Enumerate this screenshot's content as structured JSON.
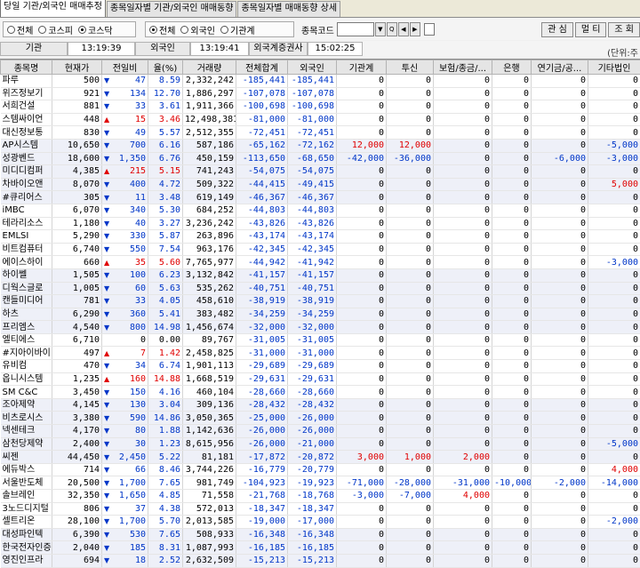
{
  "tabs": [
    "당일 기관/외국인 매매추정",
    "종목일자별 기관/외국인 매매동향",
    "종목일자별 매매동향 상세"
  ],
  "market_filter": {
    "options": [
      "전체",
      "코스피",
      "코스닥"
    ],
    "selected": "코스닥"
  },
  "investor_filter": {
    "options": [
      "전체",
      "외국인",
      "기관계"
    ],
    "selected": "전체"
  },
  "code_label": "종목코드",
  "right_buttons": [
    "관 심",
    "멀 티",
    "조 회"
  ],
  "times": {
    "inst_label": "기관",
    "inst_time": "13:19:39",
    "frgn_label": "외국인",
    "frgn_time": "13:19:41",
    "broker_label": "외국계증권사",
    "broker_time": "15:02:25"
  },
  "unit_label": "(단위:주",
  "columns": [
    "종목명",
    "현재가",
    "전일비",
    "율(%)",
    "거래량",
    "전체합계",
    "외국인",
    "기관계",
    "투신",
    "보험/종금/...",
    "은행",
    "연기금/공...",
    "기타법인"
  ],
  "colors": {
    "up": "#e00000",
    "down": "#0036c8",
    "alt_row": "#eef0f8"
  },
  "rows": [
    [
      "파루",
      "500",
      "dn",
      "47",
      "8.59",
      "2,332,242",
      "-185,441",
      "-185,441",
      "0",
      "0",
      "0",
      "0",
      "0",
      "0"
    ],
    [
      "위즈정보기",
      "921",
      "dn",
      "134",
      "12.70",
      "1,886,297",
      "-107,078",
      "-107,078",
      "0",
      "0",
      "0",
      "0",
      "0",
      "0"
    ],
    [
      "서희건설",
      "881",
      "dn",
      "33",
      "3.61",
      "1,911,366",
      "-100,698",
      "-100,698",
      "0",
      "0",
      "0",
      "0",
      "0",
      "0"
    ],
    [
      "스템싸이언",
      "448",
      "up",
      "15",
      "3.46",
      "12,498,381",
      "-81,000",
      "-81,000",
      "0",
      "0",
      "0",
      "0",
      "0",
      "0"
    ],
    [
      "대신정보통",
      "830",
      "dn",
      "49",
      "5.57",
      "2,512,355",
      "-72,451",
      "-72,451",
      "0",
      "0",
      "0",
      "0",
      "0",
      "0"
    ],
    [
      "AP시스템",
      "10,650",
      "dn",
      "700",
      "6.16",
      "587,186",
      "-65,162",
      "-72,162",
      "12,000",
      "12,000",
      "0",
      "0",
      "0",
      "-5,000"
    ],
    [
      "성광벤드",
      "18,600",
      "dn",
      "1,350",
      "6.76",
      "450,159",
      "-113,650",
      "-68,650",
      "-42,000",
      "-36,000",
      "0",
      "0",
      "-6,000",
      "-3,000"
    ],
    [
      "미디디컴퍼",
      "4,385",
      "up",
      "215",
      "5.15",
      "741,243",
      "-54,075",
      "-54,075",
      "0",
      "0",
      "0",
      "0",
      "0",
      "0"
    ],
    [
      "차바이오앤",
      "8,070",
      "dn",
      "400",
      "4.72",
      "509,322",
      "-44,415",
      "-49,415",
      "0",
      "0",
      "0",
      "0",
      "0",
      "5,000"
    ],
    [
      "#큐리어스",
      "305",
      "dn",
      "11",
      "3.48",
      "619,149",
      "-46,367",
      "-46,367",
      "0",
      "0",
      "0",
      "0",
      "0",
      "0"
    ],
    [
      "iMBC",
      "6,070",
      "dn",
      "340",
      "5.30",
      "684,252",
      "-44,803",
      "-44,803",
      "0",
      "0",
      "0",
      "0",
      "0",
      "0"
    ],
    [
      "테라리소스",
      "1,180",
      "dn",
      "40",
      "3.27",
      "3,236,242",
      "-43,826",
      "-43,826",
      "0",
      "0",
      "0",
      "0",
      "0",
      "0"
    ],
    [
      "EMLSI",
      "5,290",
      "dn",
      "330",
      "5.87",
      "263,896",
      "-43,174",
      "-43,174",
      "0",
      "0",
      "0",
      "0",
      "0",
      "0"
    ],
    [
      "비트컴퓨터",
      "6,740",
      "dn",
      "550",
      "7.54",
      "963,176",
      "-42,345",
      "-42,345",
      "0",
      "0",
      "0",
      "0",
      "0",
      "0"
    ],
    [
      "에이스하이",
      "660",
      "up",
      "35",
      "5.60",
      "7,765,977",
      "-44,942",
      "-41,942",
      "0",
      "0",
      "0",
      "0",
      "0",
      "-3,000"
    ],
    [
      "하이쎌",
      "1,505",
      "dn",
      "100",
      "6.23",
      "3,132,842",
      "-41,157",
      "-41,157",
      "0",
      "0",
      "0",
      "0",
      "0",
      "0"
    ],
    [
      "디웍스글로",
      "1,005",
      "dn",
      "60",
      "5.63",
      "535,262",
      "-40,751",
      "-40,751",
      "0",
      "0",
      "0",
      "0",
      "0",
      "0"
    ],
    [
      "캔들미디어",
      "781",
      "dn",
      "33",
      "4.05",
      "458,610",
      "-38,919",
      "-38,919",
      "0",
      "0",
      "0",
      "0",
      "0",
      "0"
    ],
    [
      "하츠",
      "6,290",
      "dn",
      "360",
      "5.41",
      "383,482",
      "-34,259",
      "-34,259",
      "0",
      "0",
      "0",
      "0",
      "0",
      "0"
    ],
    [
      "프리엠스",
      "4,540",
      "dn",
      "800",
      "14.98",
      "1,456,674",
      "-32,000",
      "-32,000",
      "0",
      "0",
      "0",
      "0",
      "0",
      "0"
    ],
    [
      "엘티에스",
      "6,710",
      "flat",
      "0",
      "0.00",
      "89,767",
      "-31,005",
      "-31,005",
      "0",
      "0",
      "0",
      "0",
      "0",
      "0"
    ],
    [
      "#지아이바이",
      "497",
      "up",
      "7",
      "1.42",
      "2,458,825",
      "-31,000",
      "-31,000",
      "0",
      "0",
      "0",
      "0",
      "0",
      "0"
    ],
    [
      "유비컴",
      "470",
      "dn",
      "34",
      "6.74",
      "1,901,113",
      "-29,689",
      "-29,689",
      "0",
      "0",
      "0",
      "0",
      "0",
      "0"
    ],
    [
      "옵니시스템",
      "1,235",
      "up",
      "160",
      "14.88",
      "1,668,519",
      "-29,631",
      "-29,631",
      "0",
      "0",
      "0",
      "0",
      "0",
      "0"
    ],
    [
      "SM C&C",
      "3,450",
      "dn",
      "150",
      "4.16",
      "460,104",
      "-28,660",
      "-28,660",
      "0",
      "0",
      "0",
      "0",
      "0",
      "0"
    ],
    [
      "조아제약",
      "4,145",
      "dn",
      "130",
      "3.04",
      "309,136",
      "-28,432",
      "-28,432",
      "0",
      "0",
      "0",
      "0",
      "0",
      "0"
    ],
    [
      "비츠로시스",
      "3,380",
      "dn",
      "590",
      "14.86",
      "3,050,365",
      "-25,000",
      "-26,000",
      "0",
      "0",
      "0",
      "0",
      "0",
      "0"
    ],
    [
      "넥센테크",
      "4,170",
      "dn",
      "80",
      "1.88",
      "1,142,636",
      "-26,000",
      "-26,000",
      "0",
      "0",
      "0",
      "0",
      "0",
      "0"
    ],
    [
      "삼천당제약",
      "2,400",
      "dn",
      "30",
      "1.23",
      "8,615,956",
      "-26,000",
      "-21,000",
      "0",
      "0",
      "0",
      "0",
      "0",
      "-5,000"
    ],
    [
      "씨젠",
      "44,450",
      "dn",
      "2,450",
      "5.22",
      "81,181",
      "-17,872",
      "-20,872",
      "3,000",
      "1,000",
      "2,000",
      "0",
      "0",
      "0"
    ],
    [
      "에듀박스",
      "714",
      "dn",
      "66",
      "8.46",
      "3,744,226",
      "-16,779",
      "-20,779",
      "0",
      "0",
      "0",
      "0",
      "0",
      "4,000"
    ],
    [
      "서울반도체",
      "20,500",
      "dn",
      "1,700",
      "7.65",
      "981,749",
      "-104,923",
      "-19,923",
      "-71,000",
      "-28,000",
      "-31,000",
      "-10,000",
      "-2,000",
      "-14,000"
    ],
    [
      "솔브레인",
      "32,350",
      "dn",
      "1,650",
      "4.85",
      "71,558",
      "-21,768",
      "-18,768",
      "-3,000",
      "-7,000",
      "4,000",
      "0",
      "0",
      "0"
    ],
    [
      "3노드디지털",
      "806",
      "dn",
      "37",
      "4.38",
      "572,013",
      "-18,347",
      "-18,347",
      "0",
      "0",
      "0",
      "0",
      "0",
      "0"
    ],
    [
      "셀트리온",
      "28,100",
      "dn",
      "1,700",
      "5.70",
      "2,013,585",
      "-19,000",
      "-17,000",
      "0",
      "0",
      "0",
      "0",
      "0",
      "-2,000"
    ],
    [
      "대성파인텍",
      "6,390",
      "dn",
      "530",
      "7.65",
      "508,933",
      "-16,348",
      "-16,348",
      "0",
      "0",
      "0",
      "0",
      "0",
      "0"
    ],
    [
      "한국전자인증",
      "2,040",
      "dn",
      "185",
      "8.31",
      "1,087,993",
      "-16,185",
      "-16,185",
      "0",
      "0",
      "0",
      "0",
      "0",
      "0"
    ],
    [
      "영진인프라",
      "694",
      "dn",
      "18",
      "2.52",
      "2,632,509",
      "-15,213",
      "-15,213",
      "0",
      "0",
      "0",
      "0",
      "0",
      "0"
    ]
  ]
}
